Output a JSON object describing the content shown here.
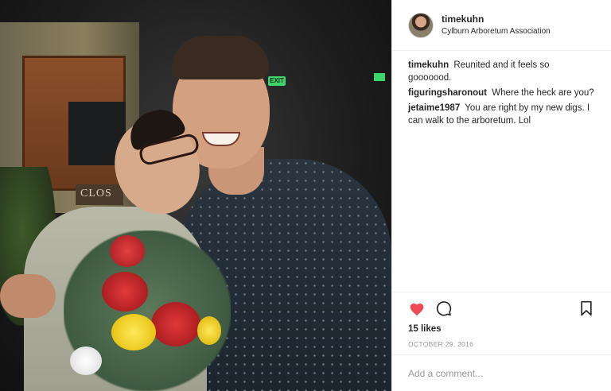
{
  "post": {
    "header": {
      "username": "timekuhn",
      "location": "Cylburn Arboretum Association"
    },
    "photo": {
      "sign_text": "CLOS",
      "exit_text": "EXIT"
    },
    "comments": [
      {
        "user": "timekuhn",
        "text": "Reunited and it feels so gooooood."
      },
      {
        "user": "figuringsharonout",
        "text": "Where the heck are you?"
      },
      {
        "user": "jetaime1987",
        "text": "You are right by my new digs. I can walk to the arboretum. Lol"
      }
    ],
    "actions": {
      "like_icon": "heart-filled-icon",
      "comment_icon": "speech-bubble-icon",
      "save_icon": "bookmark-icon",
      "like_color": "#ed4956"
    },
    "likes": "15 likes",
    "date": "OCTOBER 29, 2016",
    "add_comment": {
      "placeholder": "Add a comment..."
    }
  }
}
